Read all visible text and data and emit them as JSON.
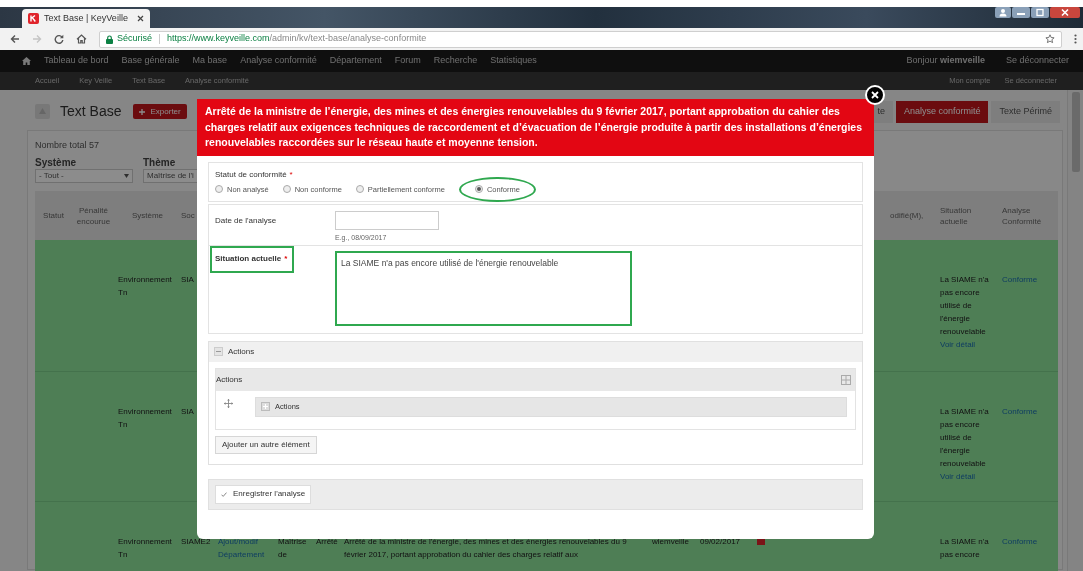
{
  "browser": {
    "tab_title": "Text Base | KeyVeille",
    "secure_label": "Sécurisé",
    "url_host": "https://www.keyveille.com",
    "url_path": "/admin/kv/text-base/analyse-conformite"
  },
  "nav": {
    "items": [
      "Tableau de bord",
      "Base générale",
      "Ma base",
      "Analyse conformité",
      "Département",
      "Forum",
      "Recherche",
      "Statistiques"
    ],
    "greeting": "Bonjour **wiemveille**",
    "logout": "Se déconnecter"
  },
  "subnav": {
    "items": [
      "Accueil",
      "Key Veille",
      "Text Base",
      "Analyse conformité"
    ],
    "account": "Mon compte",
    "logout": "Se déconnecter"
  },
  "page": {
    "title": "Text Base",
    "export_button": "Exporter",
    "tabs": [
      {
        "label": "te",
        "selected": false
      },
      {
        "label": "Analyse conformité",
        "selected": true
      },
      {
        "label": "Texte Périmé",
        "selected": false
      }
    ],
    "total": "Nombre total 57",
    "filters": [
      {
        "label": "Système",
        "value": "- Tout -"
      },
      {
        "label": "Thème",
        "value": "Maîtrise de l'i"
      }
    ]
  },
  "table": {
    "left_columns": [
      "Statut",
      "Pénalité encourue",
      "Système",
      "Soc"
    ],
    "right_columns": [
      "odifié(M),",
      "Situation actuelle",
      "Analyse Conformité"
    ],
    "rows": [
      {
        "system": "Environnement Tn",
        "company": "SIA",
        "situation": "La SIAME n'a pas encore utilisé de l'énergie renouvelable",
        "detail_link": "Voir détail",
        "analysis": "Conforme"
      },
      {
        "system": "Environnement Tn",
        "company": "SIA",
        "situation": "La SIAME n'a pas encore utilisé de l'énergie renouvelable",
        "detail_link": "Voir détail",
        "analysis": "Conforme"
      },
      {
        "system": "Environnement Tn",
        "company": "SIAME2",
        "middle": [
          {
            "kind": "link",
            "text": "Ajout/modif Département"
          },
          {
            "kind": "text",
            "text": "Maîtrise de"
          },
          {
            "kind": "text",
            "text": "Arrêté"
          },
          {
            "kind": "text",
            "text": "Arrêté de la ministre de l'énergie, des mines et des énergies renouvelables du 9 février 2017, portant approbation du cahier des charges relatif aux"
          },
          {
            "kind": "text",
            "text": "wiemveille"
          },
          {
            "kind": "text",
            "text": "09/02/2017"
          },
          {
            "kind": "icon"
          }
        ],
        "situation": "La SIAME n'a pas encore",
        "analysis": "Conforme"
      }
    ]
  },
  "modal": {
    "title": "Arrêté de la ministre de l’énergie, des mines et des énergies renouvelables du 9 février 2017, portant approbation du cahier des charges relatif aux exigences techniques de raccordement et d’évacuation de l’énergie produite à partir des installations d’énergies renouvelables raccordées sur le réseau haute et moyenne tension.",
    "status": {
      "label": "Statut de conformité",
      "required_mark": "*",
      "options": [
        {
          "label": "Non analysé",
          "selected": false,
          "annotated": false
        },
        {
          "label": "Non conforme",
          "selected": false,
          "annotated": false
        },
        {
          "label": "Partiellement conforme",
          "selected": false,
          "annotated": false
        },
        {
          "label": "Conforme",
          "selected": true,
          "annotated": true
        }
      ]
    },
    "date": {
      "label": "Date de l'analyse",
      "hint": "E.g., 08/09/2017"
    },
    "situation": {
      "label": "Situation actuelle",
      "required_mark": "*",
      "label_annotated": true,
      "value": "La SIAME n'a pas encore utilisé de l'énergie renouvelable",
      "value_annotated": true
    },
    "actions": {
      "legend": "Actions",
      "expanded": true,
      "table_header": "Actions",
      "item_label": "Actions",
      "item_expanded": false,
      "add_button": "Ajouter un autre élément"
    },
    "save_button": "Enregistrer l'analyse"
  }
}
